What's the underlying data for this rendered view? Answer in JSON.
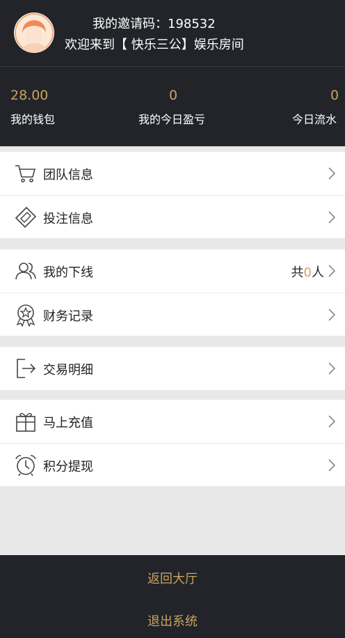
{
  "header": {
    "invite_label": "我的邀请码：198532",
    "welcome_text": "欢迎来到【 快乐三公】娱乐房间"
  },
  "stats": [
    {
      "value": "28.00",
      "label": "我的钱包"
    },
    {
      "value": "0",
      "label": "我的今日盈亏"
    },
    {
      "value": "0",
      "label": "今日流水"
    }
  ],
  "menu": {
    "team": {
      "label": "团队信息",
      "icon": "cart-icon"
    },
    "bets": {
      "label": "投注信息",
      "icon": "ticket-icon"
    },
    "downline": {
      "label": "我的下线",
      "icon": "users-icon",
      "count_prefix": "共",
      "count": "0",
      "count_suffix": "人"
    },
    "finance": {
      "label": "财务记录",
      "icon": "award-badge-icon"
    },
    "transactions": {
      "label": "交易明细",
      "icon": "exit-icon"
    },
    "recharge": {
      "label": "马上充值",
      "icon": "gift-icon"
    },
    "withdraw": {
      "label": "积分提现",
      "icon": "alarm-clock-icon"
    }
  },
  "footer": {
    "back_label": "返回大厅",
    "logout_label": "退出系统"
  },
  "colors": {
    "dark_bg": "#22242a",
    "accent_gold": "#c9a45c",
    "page_bg": "#e8e8e8"
  }
}
